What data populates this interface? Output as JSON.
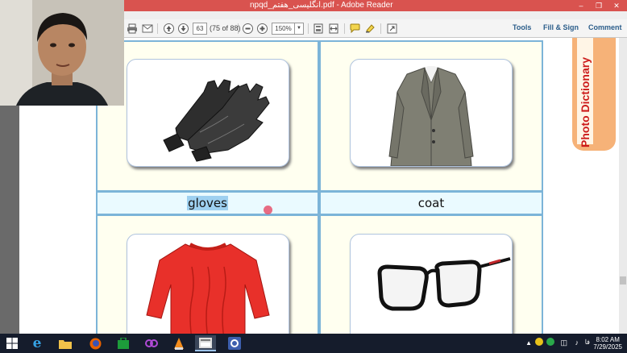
{
  "window": {
    "title": "npqd_انگلیسی_هفتم.pdf - Adobe Reader",
    "minimize": "–",
    "maximize": "❐",
    "close": "✕"
  },
  "toolbar": {
    "page_number": "63",
    "page_count": "(75 of 88)",
    "zoom": "150%",
    "tools_label": "Tools",
    "fill_sign_label": "Fill & Sign",
    "comment_label": "Comment"
  },
  "document": {
    "side_tab_title": "Photo Dictionary",
    "items": [
      {
        "label": "gloves",
        "image": "gloves-photo",
        "selected": true
      },
      {
        "label": "coat",
        "image": "coat-photo",
        "selected": false
      },
      {
        "label": "",
        "image": "sweater-photo",
        "selected": false
      },
      {
        "label": "",
        "image": "glasses-photo",
        "selected": false
      }
    ]
  },
  "taskbar": {
    "clock_time": "8:02 AM",
    "clock_date": "7/29/2025",
    "tray_lang": "فا"
  },
  "colors": {
    "titlebar": "#d9534f",
    "cell_border": "#7cb4d8",
    "tab_orange": "#f6b278",
    "tab_text": "#cc1a1a"
  }
}
